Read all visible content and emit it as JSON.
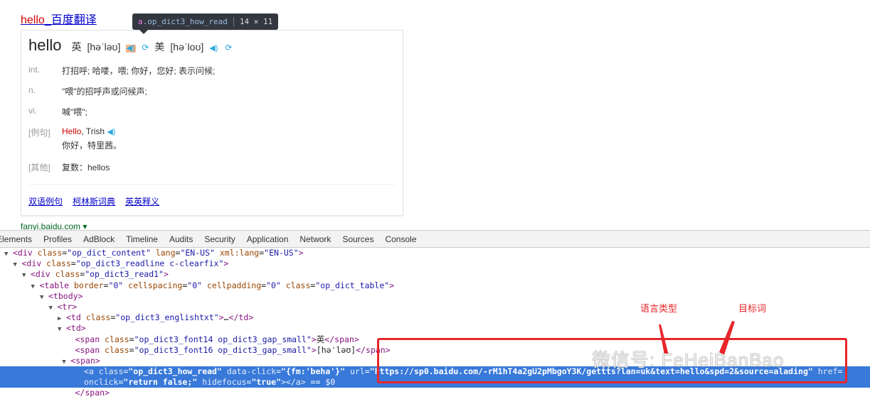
{
  "page": {
    "title_hl": "hello",
    "title_rest": "_百度翻译",
    "site": "fanyi.baidu.com ▾"
  },
  "card": {
    "word": "hello",
    "uk_label": "英",
    "uk_ipa": "[həˈləʊ]",
    "us_label": "美",
    "us_ipa": "[həˈloʊ]",
    "defs": [
      {
        "pos": "int.",
        "text": "打招呼; 哈喽，喂; 你好，您好; 表示问候;"
      },
      {
        "pos": "n.",
        "text": "\"喂\"的招呼声或问候声;"
      },
      {
        "pos": "vi.",
        "text": "喊\"喂\";"
      }
    ],
    "example": {
      "label": "[例句]",
      "en_hl": "Hello",
      "en_rest": ", Trish",
      "zh": "你好，特里茜。"
    },
    "other": {
      "label": "[其他]",
      "text": "复数：hellos"
    },
    "links": [
      "双语例句",
      "柯林斯词典",
      "英英释义"
    ]
  },
  "tooltip": {
    "tag": "a",
    "cls": ".op_dict3_how_read",
    "size": "14 × 11"
  },
  "devtools": {
    "tabs": [
      "Elements",
      "Profiles",
      "AdBlock",
      "Timeline",
      "Audits",
      "Security",
      "Application",
      "Network",
      "Sources",
      "Console"
    ],
    "selected_tab": "Elements",
    "lines": [
      {
        "i": 0,
        "tri": "▼",
        "segs": [
          [
            "t",
            "<div "
          ],
          [
            "a",
            "class"
          ],
          [
            "p",
            "="
          ],
          [
            "v",
            "\"op_dict_content\""
          ],
          [
            "a",
            " lang"
          ],
          [
            "p",
            "="
          ],
          [
            "v",
            "\"EN-US\""
          ],
          [
            "a",
            " xml:lang"
          ],
          [
            "p",
            "="
          ],
          [
            "v",
            "\"EN-US\""
          ],
          [
            "t",
            ">"
          ]
        ]
      },
      {
        "i": 1,
        "tri": "▼",
        "segs": [
          [
            "t",
            "<div "
          ],
          [
            "a",
            "class"
          ],
          [
            "p",
            "="
          ],
          [
            "v",
            "\"op_dict3_readline c-clearfix\""
          ],
          [
            "t",
            ">"
          ]
        ]
      },
      {
        "i": 2,
        "tri": "▼",
        "segs": [
          [
            "t",
            "<div "
          ],
          [
            "a",
            "class"
          ],
          [
            "p",
            "="
          ],
          [
            "v",
            "\"op_dict3_read1\""
          ],
          [
            "t",
            ">"
          ]
        ]
      },
      {
        "i": 3,
        "tri": "▼",
        "segs": [
          [
            "t",
            "<table "
          ],
          [
            "a",
            "border"
          ],
          [
            "p",
            "="
          ],
          [
            "v",
            "\"0\""
          ],
          [
            "a",
            " cellspacing"
          ],
          [
            "p",
            "="
          ],
          [
            "v",
            "\"0\""
          ],
          [
            "a",
            " cellpadding"
          ],
          [
            "p",
            "="
          ],
          [
            "v",
            "\"0\""
          ],
          [
            "a",
            " class"
          ],
          [
            "p",
            "="
          ],
          [
            "v",
            "\"op_dict_table\""
          ],
          [
            "t",
            ">"
          ]
        ]
      },
      {
        "i": 4,
        "tri": "▼",
        "segs": [
          [
            "t",
            "<tbody>"
          ]
        ]
      },
      {
        "i": 5,
        "tri": "▼",
        "segs": [
          [
            "t",
            "<tr>"
          ]
        ]
      },
      {
        "i": 6,
        "tri": "▶",
        "segs": [
          [
            "t",
            "<td "
          ],
          [
            "a",
            "class"
          ],
          [
            "p",
            "="
          ],
          [
            "v",
            "\"op_dict3_englishtxt\""
          ],
          [
            "t",
            ">"
          ],
          [
            "p",
            "…"
          ],
          [
            "t",
            "</td>"
          ]
        ]
      },
      {
        "i": 6,
        "tri": "▼",
        "segs": [
          [
            "t",
            "<td>"
          ]
        ]
      },
      {
        "i": 7,
        "tri": "",
        "segs": [
          [
            "t",
            "<span "
          ],
          [
            "a",
            "class"
          ],
          [
            "p",
            "="
          ],
          [
            "v",
            "\"op_dict3_font14 op_dict3_gap_small\""
          ],
          [
            "t",
            ">"
          ],
          [
            "p",
            "英"
          ],
          [
            "t",
            "</span>"
          ]
        ]
      },
      {
        "i": 7,
        "tri": "",
        "segs": [
          [
            "t",
            "<span "
          ],
          [
            "a",
            "class"
          ],
          [
            "p",
            "="
          ],
          [
            "v",
            "\"op_dict3_font16 op_dict3_gap_small\""
          ],
          [
            "t",
            ">"
          ],
          [
            "p",
            "[həˈləʊ]"
          ],
          [
            "t",
            "</span>"
          ]
        ]
      },
      {
        "i": 6.5,
        "tri": "▼",
        "segs": [
          [
            "t",
            "<span>"
          ]
        ]
      },
      {
        "i": 8,
        "tri": "",
        "sel": true,
        "segs": [
          [
            "t",
            "<a "
          ],
          [
            "a",
            "class"
          ],
          [
            "p",
            "="
          ],
          [
            "v",
            "\"op_dict3_how_read\""
          ],
          [
            "a",
            " data-click"
          ],
          [
            "p",
            "="
          ],
          [
            "v",
            "\"{fm:'beha'}\""
          ],
          [
            "a",
            " url"
          ],
          [
            "p",
            "="
          ],
          [
            "v",
            "\"https://sp0.baidu.com/-rM1hT4a2gU2pMbgoY3K/gettts?lan=uk&text=hello&spd=2&source=alading\""
          ],
          [
            "a",
            " href"
          ],
          [
            "p",
            "="
          ]
        ]
      },
      {
        "i": 8,
        "tri": "",
        "sel": true,
        "segs": [
          [
            "a",
            "onclick"
          ],
          [
            "p",
            "="
          ],
          [
            "v",
            "\"return false;\""
          ],
          [
            "a",
            " hidefocus"
          ],
          [
            "p",
            "="
          ],
          [
            "v",
            "\"true\""
          ],
          [
            "t",
            "></a>"
          ],
          [
            "p",
            " == $0"
          ]
        ]
      },
      {
        "i": 7,
        "tri": "",
        "segs": [
          [
            "t",
            "</span>"
          ]
        ]
      }
    ]
  },
  "annotations": {
    "lang": "语言类型",
    "target": "目标词",
    "accent": "#e8262a"
  },
  "watermark": "微信号: FeHeiBanBao"
}
